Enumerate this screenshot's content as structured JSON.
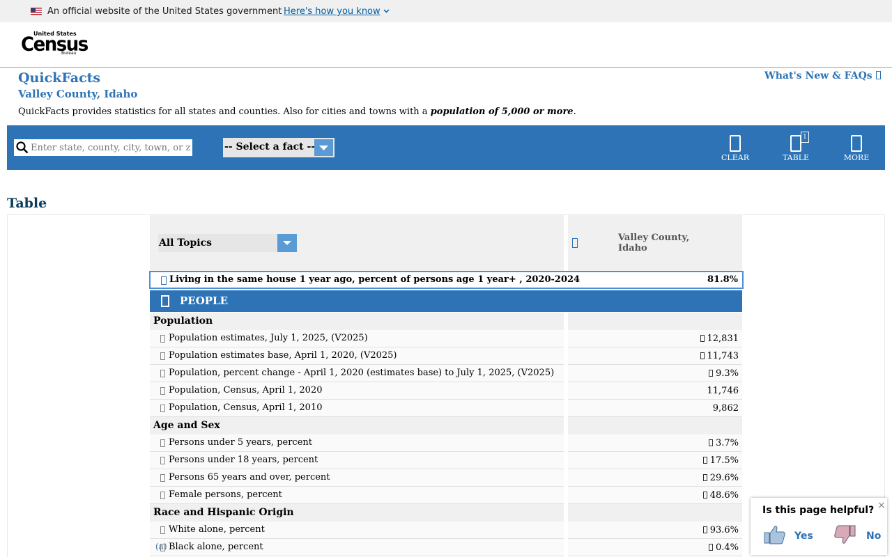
{
  "gov_banner": {
    "official_text": "An official website of the United States government",
    "how_you_know": "Here's how you know"
  },
  "logo": {
    "line1": "United States",
    "line2": "Census",
    "line3": "Bureau"
  },
  "page": {
    "title": "QuickFacts",
    "location": "Valley County, Idaho",
    "description_prefix": "QuickFacts provides statistics for all states and counties. Also for cities and towns with a ",
    "description_emphasis": "population of 5,000 or more",
    "description_suffix": ".",
    "whats_new": "What's New & FAQs"
  },
  "toolbar": {
    "search_placeholder": "Enter state, county, city, town, or zip code",
    "fact_select": "-- Select a fact --",
    "clear": "CLEAR",
    "table": "TABLE",
    "table_badge": "1",
    "more": "MORE",
    "accent": "#2d73b5"
  },
  "section_heading": "Table",
  "table": {
    "topic_select": "All Topics",
    "column_location": "Valley County, Idaho",
    "featured": {
      "label": "Living in the same house 1 year ago, percent of persons age 1 year+ , 2020-2024",
      "value": "81.8%"
    },
    "people_label": "PEOPLE",
    "rows": [
      {
        "type": "section",
        "label": "Population"
      },
      {
        "type": "data",
        "label": "Population estimates, July 1, 2025, (V2025)",
        "value": "12,831",
        "value_icon": true
      },
      {
        "type": "data",
        "label": "Population estimates base, April 1, 2020, (V2025)",
        "value": "11,743",
        "value_icon": true
      },
      {
        "type": "data",
        "label": "Population, percent change - April 1, 2020 (estimates base) to July 1, 2025, (V2025)",
        "value": "9.3%",
        "value_icon": true
      },
      {
        "type": "data",
        "label": "Population, Census, April 1, 2020",
        "value": "11,746",
        "value_icon": false
      },
      {
        "type": "data",
        "label": "Population, Census, April 1, 2010",
        "value": "9,862",
        "value_icon": false
      },
      {
        "type": "section",
        "label": "Age and Sex"
      },
      {
        "type": "data",
        "label": "Persons under 5 years, percent",
        "value": "3.7%",
        "value_icon": true
      },
      {
        "type": "data",
        "label": "Persons under 18 years, percent",
        "value": "17.5%",
        "value_icon": true
      },
      {
        "type": "data",
        "label": "Persons 65 years and over, percent",
        "value": "29.6%",
        "value_icon": true
      },
      {
        "type": "data",
        "label": "Female persons, percent",
        "value": "48.6%",
        "value_icon": true
      },
      {
        "type": "section",
        "label": "Race and Hispanic Origin"
      },
      {
        "type": "data",
        "label": "White alone, percent",
        "value": "93.6%",
        "value_icon": true
      },
      {
        "type": "data",
        "label": "Black alone, percent",
        "note": "(a)",
        "value": "0.4%",
        "value_icon": true
      }
    ]
  },
  "feedback": {
    "question": "Is this page helpful?",
    "yes": "Yes",
    "no": "No",
    "close": "×"
  }
}
